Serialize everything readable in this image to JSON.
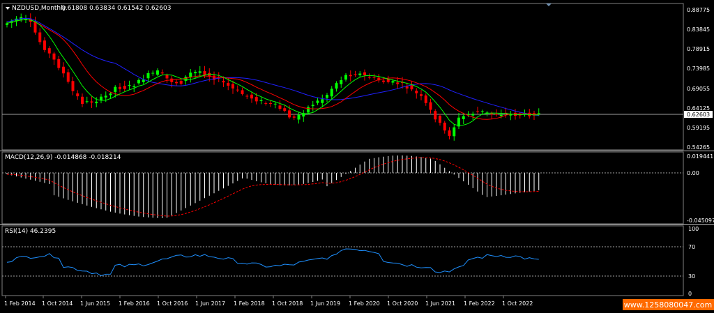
{
  "main": {
    "symbol": "NZDUSD,Monthly",
    "ohlc": "0.61808 0.63834 0.61542 0.62603",
    "price_label": "0.62603",
    "price_ticks": [
      "0.88775",
      "0.83845",
      "0.78915",
      "0.73985",
      "0.69055",
      "0.64125",
      "0.59195",
      "0.54265"
    ]
  },
  "macd": {
    "label": "MACD(12,26,9) -0.014868 -0.018214",
    "ticks": [
      "0.019441",
      "0.00",
      "-0.045097"
    ]
  },
  "rsi": {
    "label": "RSI(14) 46.2395",
    "ticks": [
      "100",
      "70",
      "30",
      "0"
    ]
  },
  "time_axis": [
    "1 Feb 2014",
    "1 Oct 2014",
    "1 Jun 2015",
    "1 Feb 2016",
    "1 Oct 2016",
    "1 Jun 2017",
    "1 Feb 2018",
    "1 Oct 2018",
    "1 Jun 2019",
    "1 Feb 2020",
    "1 Oct 2020",
    "1 Jun 2021",
    "1 Feb 2022",
    "1 Oct 2022"
  ],
  "watermark": "www.1258080047.com",
  "colors": {
    "bull": "#00ff00",
    "bear": "#ff0000",
    "ma_fast": "#00ff00",
    "ma_mid": "#ff0000",
    "ma_slow": "#2020ff",
    "rsi_line": "#1e90ff",
    "macd_signal": "#ff0000",
    "grid": "#808080",
    "watermark_bg": "#ff6a00"
  }
}
